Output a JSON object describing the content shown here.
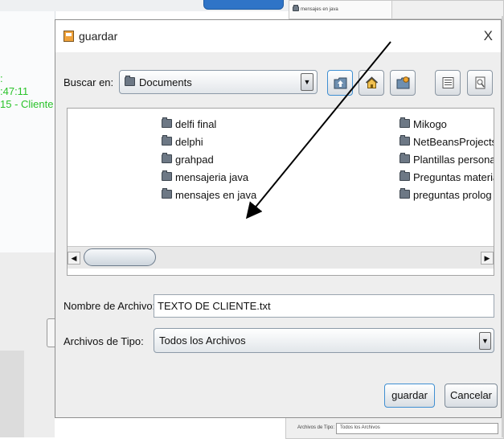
{
  "background": {
    "top_mini_label": "mensajes en java",
    "left_lines": [
      ":",
      ":47:11",
      "15 - Cliente :"
    ],
    "bottom_label": "Archivos de Tipo:",
    "bottom_value": "Todos los Archivos",
    "green_color": "#2ac32a"
  },
  "dialog": {
    "title": "guardar",
    "close_glyph": "X",
    "lookin_label": "Buscar en:",
    "lookin_value": "Documents",
    "files_left": [
      "delfi final",
      "delphi",
      "grahpad",
      "mensajeria java",
      "mensajes en java"
    ],
    "files_right": [
      "Mikogo",
      "NetBeansProjects",
      "Plantillas personaliz",
      "Preguntas materia F",
      "preguntas prolog"
    ],
    "filename_label": "Nombre de Archivo:",
    "filename_value": "TEXTO DE CLIENTE.txt",
    "filetype_label": "Archivos de Tipo:",
    "filetype_value": "Todos los Archivos",
    "save_label": "guardar",
    "cancel_label": "Cancelar",
    "toolbar_icons": [
      "up-folder-icon",
      "home-icon",
      "new-folder-icon",
      "list-view-icon",
      "details-view-icon"
    ]
  },
  "colors": {
    "accent": "#3f8fd2",
    "folder": "#6d7885"
  }
}
